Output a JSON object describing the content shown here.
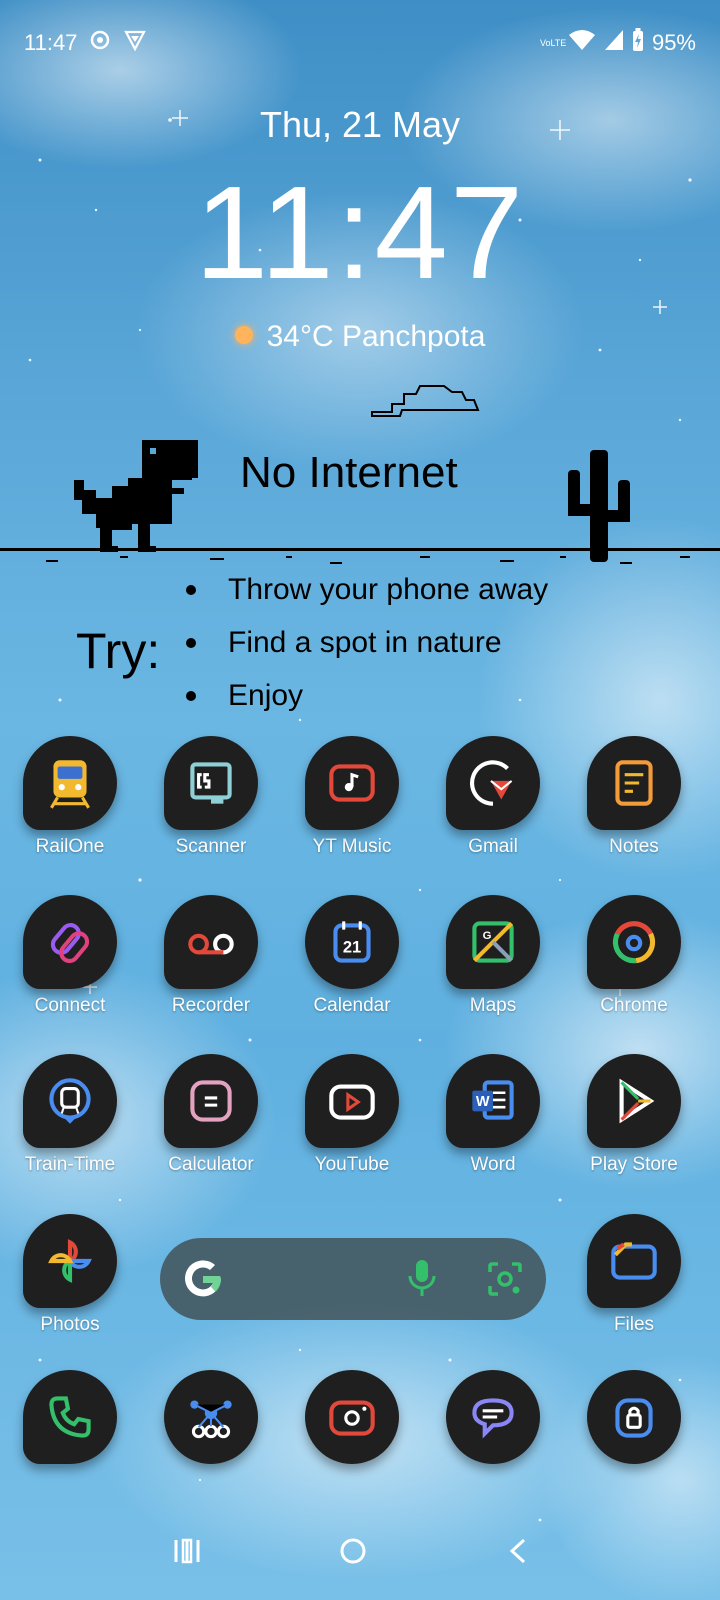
{
  "status_bar": {
    "time": "11:47",
    "network": "VoLTE",
    "battery": "95%",
    "icons": [
      "settings-icon",
      "vpn-shield-icon",
      "wifi-icon",
      "signal-icon",
      "battery-charging-icon"
    ]
  },
  "clock_widget": {
    "date": "Thu, 21 May",
    "time": "11:47",
    "weather": "34°C Panchpota",
    "weather_icon": "sun-icon"
  },
  "no_internet_widget": {
    "title": "No Internet",
    "try_label": "Try:",
    "tips": [
      "Throw your phone away",
      "Find a spot in nature",
      "Enjoy"
    ]
  },
  "apps": {
    "row1": [
      "RailOne",
      "Scanner",
      "YT Music",
      "Gmail",
      "Notes"
    ],
    "row2": [
      "Connect",
      "Recorder",
      "Calendar",
      "Maps",
      "Chrome"
    ],
    "row3": [
      "Train-Time",
      "Calculator",
      "YouTube",
      "Word",
      "Play Store"
    ],
    "row4": [
      "Photos",
      "Files"
    ]
  },
  "search_bar": {
    "logo": "G",
    "icons": [
      "google-icon",
      "microphone-icon",
      "lens-icon"
    ]
  },
  "dock": {
    "icons": [
      "phone-icon",
      "share-network-icon",
      "camera-icon",
      "messages-icon",
      "lock-icon"
    ]
  },
  "navigation": {
    "icons": [
      "recents-icon",
      "home-icon",
      "back-icon"
    ]
  },
  "colors": {
    "icon_bg": "#1f1f1f",
    "text": "#ffffff",
    "accent_blue": "#4a8df0",
    "accent_red": "#e2493b",
    "accent_green": "#34c06a",
    "accent_yellow": "#f2b92f"
  }
}
